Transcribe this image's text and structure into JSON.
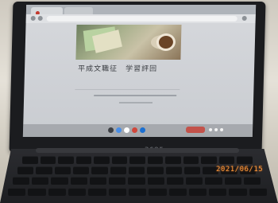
{
  "screen": {
    "form_title": "平成文職征　学習評回",
    "brand": "acer"
  },
  "timestamp": "2021/06/15",
  "colors": {
    "stamp": "#ff9a3d",
    "shelf_red": "#d0473b",
    "shelf_blue": "#4a8ee6",
    "status_red": "#c3524a"
  }
}
